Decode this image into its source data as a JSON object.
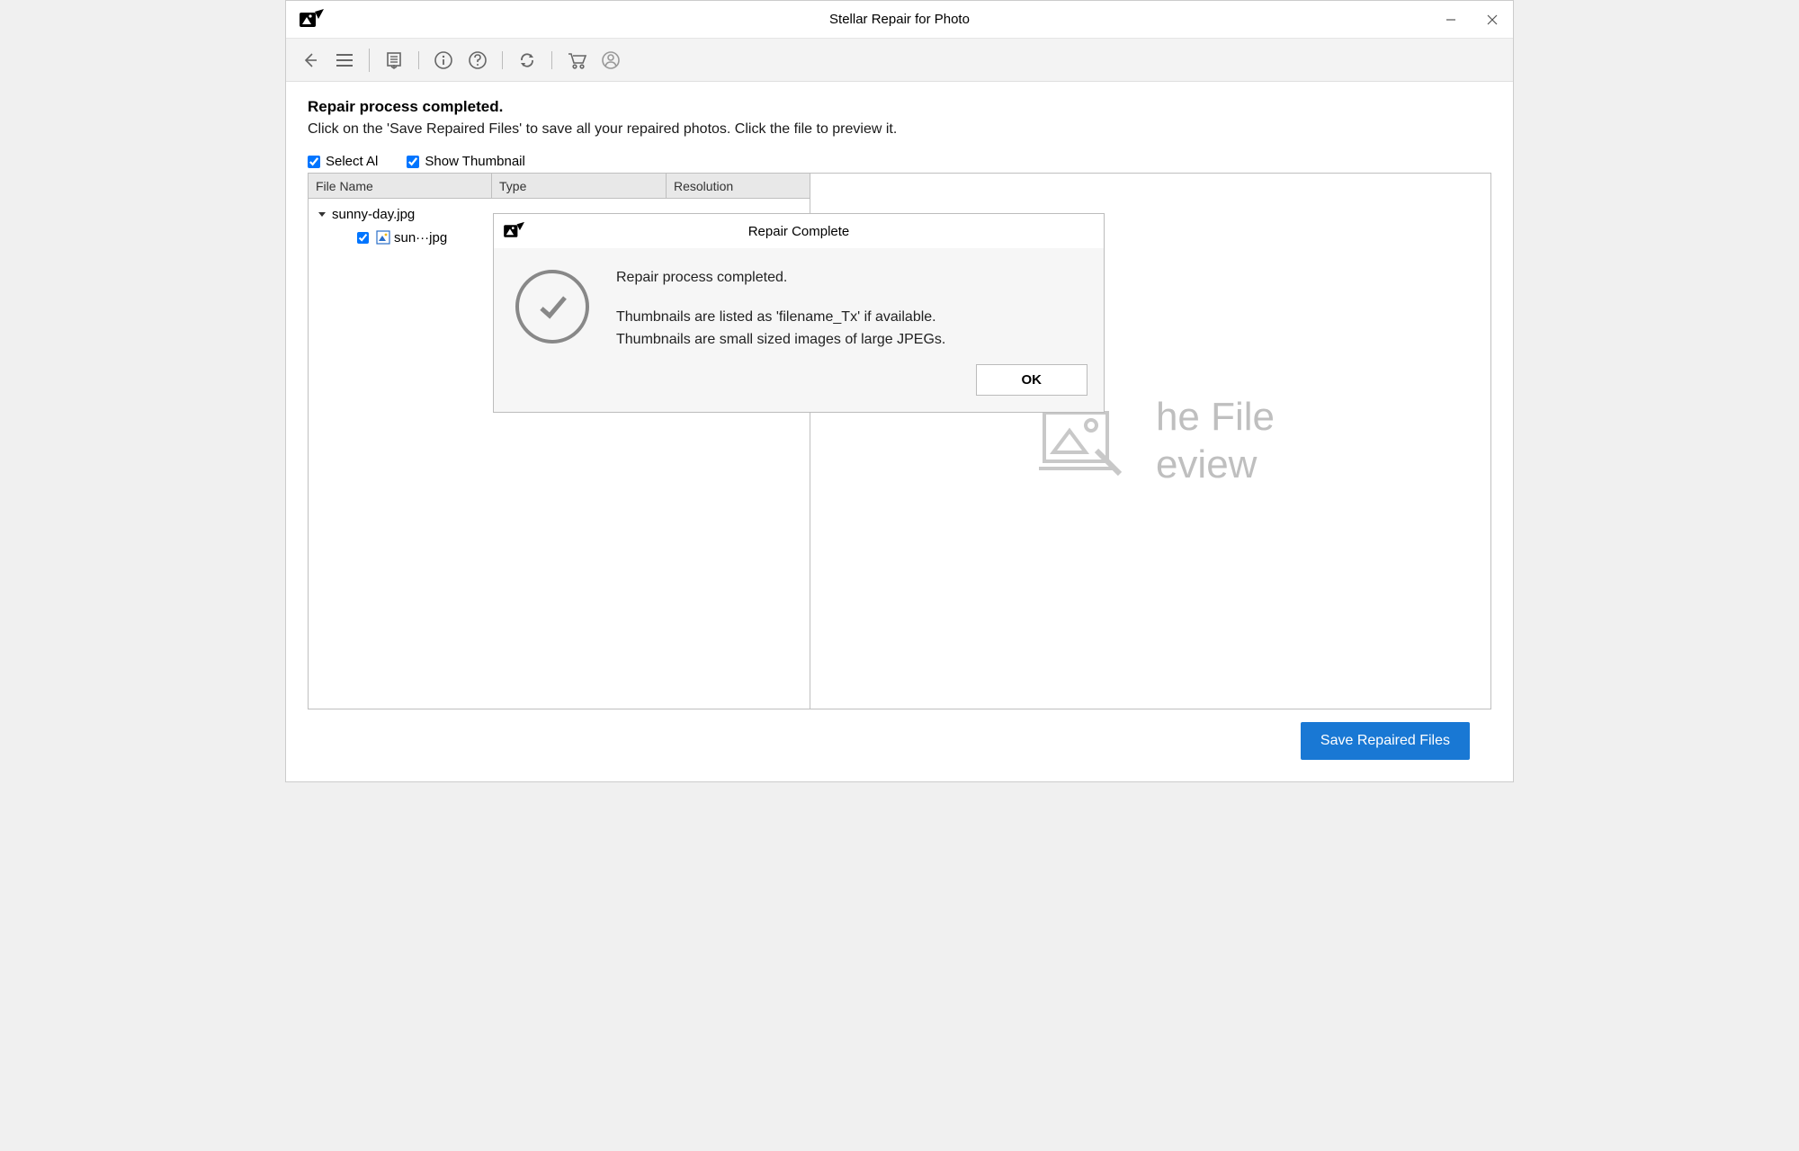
{
  "window": {
    "title": "Stellar Repair for Photo"
  },
  "heading": "Repair process completed.",
  "subtext": "Click on the 'Save Repaired Files' to save all your repaired photos. Click the file to preview it.",
  "checkboxes": {
    "select_all": {
      "label": "Select Al",
      "checked": true
    },
    "show_thumbnail": {
      "label": "Show Thumbnail",
      "checked": true
    }
  },
  "columns": [
    "File Name",
    "Type",
    "Resolution"
  ],
  "tree": {
    "parent_name": "sunny-day.jpg",
    "child_name": "sun···jpg",
    "child_checked": true
  },
  "preview": {
    "line1_partial": "he File",
    "line2_partial": "eview"
  },
  "footer": {
    "save_button": "Save Repaired Files"
  },
  "dialog": {
    "title": "Repair Complete",
    "line1": "Repair process completed.",
    "line2": "Thumbnails are listed as 'filename_Tx' if available.",
    "line3": "Thumbnails are small sized images of large JPEGs.",
    "ok": "OK"
  },
  "colors": {
    "accent": "#1978d4"
  }
}
